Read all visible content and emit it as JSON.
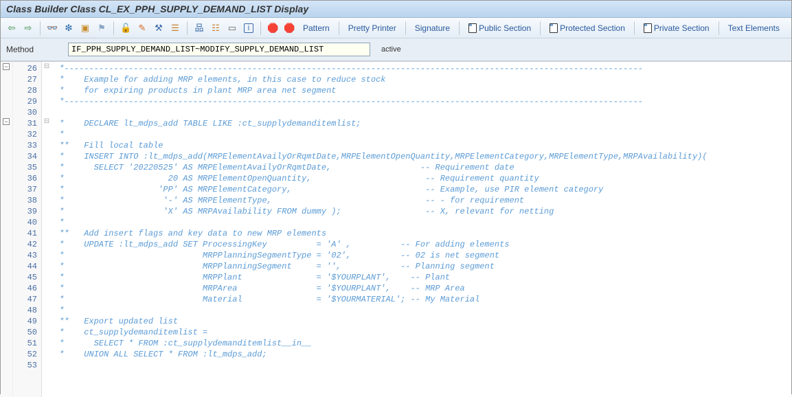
{
  "title": "Class Builder Class CL_EX_PPH_SUPPLY_DEMAND_LIST Display",
  "toolbar": {
    "pattern_label": "Pattern",
    "pretty_label": "Pretty Printer",
    "signature_label": "Signature",
    "public_label": "Public Section",
    "protected_label": "Protected Section",
    "private_label": "Private Section",
    "text_elements_label": "Text Elements"
  },
  "method": {
    "label": "Method",
    "value": "IF_PPH_SUPPLY_DEMAND_LIST~MODIFY_SUPPLY_DEMAND_LIST",
    "status": "active"
  },
  "line_numbers": [
    "26",
    "27",
    "28",
    "29",
    "30",
    "31",
    "32",
    "33",
    "34",
    "35",
    "36",
    "37",
    "38",
    "39",
    "40",
    "41",
    "42",
    "43",
    "44",
    "45",
    "46",
    "47",
    "48",
    "49",
    "50",
    "51",
    "52",
    "53"
  ],
  "struct_marks": [
    "⊟",
    "",
    "",
    "",
    "",
    "⊟",
    "",
    "",
    "",
    "",
    "",
    "",
    "",
    "",
    "",
    "",
    "",
    "",
    "",
    "",
    "",
    "",
    "",
    "",
    "",
    "",
    "",
    ""
  ],
  "code_lines": [
    " *---------------------------------------------------------------------------------------------------------------------",
    " *    Example for adding MRP elements, in this case to reduce stock",
    " *    for expiring products in plant MRP area net segment",
    " *---------------------------------------------------------------------------------------------------------------------",
    "",
    " *    DECLARE lt_mdps_add TABLE LIKE :ct_supplydemanditemlist;",
    " *",
    " **   Fill local table",
    " *    INSERT INTO :lt_mdps_add(MRPElementAvailyOrRqmtDate,MRPElementOpenQuantity,MRPElementCategory,MRPElementType,MRPAvailability)(",
    " *      SELECT '20220525' AS MRPElementAvailyOrRqmtDate,                  -- Requirement date",
    " *                     20 AS MRPElementOpenQuantity,                       -- Requirement quantity",
    " *                   'PP' AS MRPElementCategory,                           -- Example, use PIR element category",
    " *                    '-' AS MRPElementType,                               -- - for requirement",
    " *                    'X' AS MRPAvailability FROM dummy );                 -- X, relevant for netting",
    " *",
    " **   Add insert flags and key data to new MRP elements",
    " *    UPDATE :lt_mdps_add SET ProcessingKey          = 'A' ,          -- For adding elements",
    " *                            MRPPlanningSegmentType = '02',          -- 02 is net segment",
    " *                            MRPPlanningSegment     = '',            -- Planning segment",
    " *                            MRPPlant               = '$YOURPLANT',    -- Plant",
    " *                            MRPArea                = '$YOURPLANT',    -- MRP Area",
    " *                            Material               = '$YOURMATERIAL'; -- My Material",
    " *",
    " **   Export updated list",
    " *    ct_supplydemanditemlist =",
    " *      SELECT * FROM :ct_supplydemanditemlist__in__",
    " *    UNION ALL SELECT * FROM :lt_mdps_add;",
    ""
  ]
}
